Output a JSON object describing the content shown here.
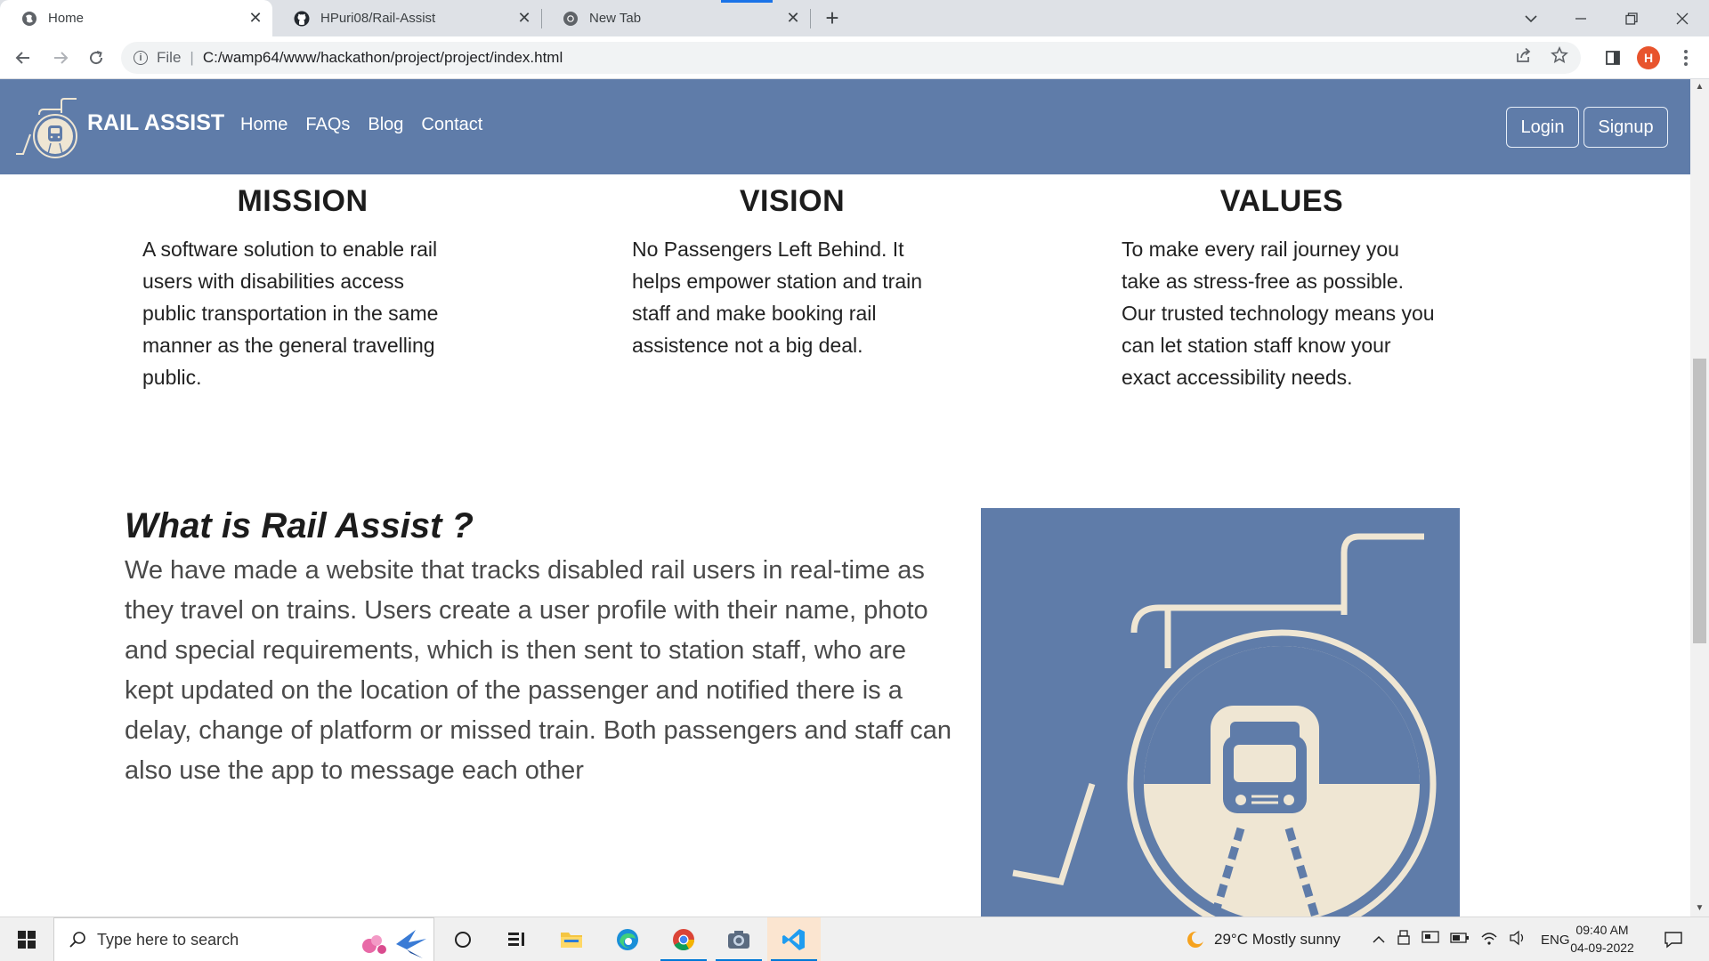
{
  "browser": {
    "tabs": [
      {
        "title": "Home",
        "active": true
      },
      {
        "title": "HPuri08/Rail-Assist",
        "active": false
      },
      {
        "title": "New Tab",
        "active": false
      }
    ],
    "address": {
      "scheme_label": "File",
      "url": "C:/wamp64/www/hackathon/project/project/index.html"
    },
    "profile_initial": "H"
  },
  "site": {
    "brand": "RAIL ASSIST",
    "nav": [
      "Home",
      "FAQs",
      "Blog",
      "Contact"
    ],
    "login_label": "Login",
    "signup_label": "Signup",
    "mission": {
      "title": "MISSION",
      "text": "A software solution to enable rail users with disabilities access public transportation in the same manner as the general travelling public."
    },
    "vision": {
      "title": "VISION",
      "text": "No Passengers Left Behind. It helps empower station and train staff and make booking rail assistence not a big deal."
    },
    "values": {
      "title": "VALUES",
      "text": "To make every rail journey you take as stress-free as possible. Our trusted technology means you can let station staff know your exact accessibility needs."
    },
    "about": {
      "title": "What is Rail Assist ?",
      "text": "We have made a website that tracks disabled rail users in real-time as they travel on trains. Users create a user profile with their name, photo and special requirements, which is then sent to station staff, who are kept updated on the location of the passenger and notified there is a delay, change of platform or missed train. Both passengers and staff can also use the app to message each other"
    },
    "colors": {
      "brand_blue": "#5f7ca9",
      "cream": "#efe6d3"
    }
  },
  "taskbar": {
    "search_placeholder": "Type here to search",
    "weather": "29°C  Mostly sunny",
    "language": "ENG",
    "time": "09:40 AM",
    "date": "04-09-2022",
    "apps": [
      "cortana-icon",
      "task-view-icon",
      "file-explorer-icon",
      "edge-icon",
      "chrome-icon",
      "camera-icon",
      "vscode-icon"
    ]
  }
}
